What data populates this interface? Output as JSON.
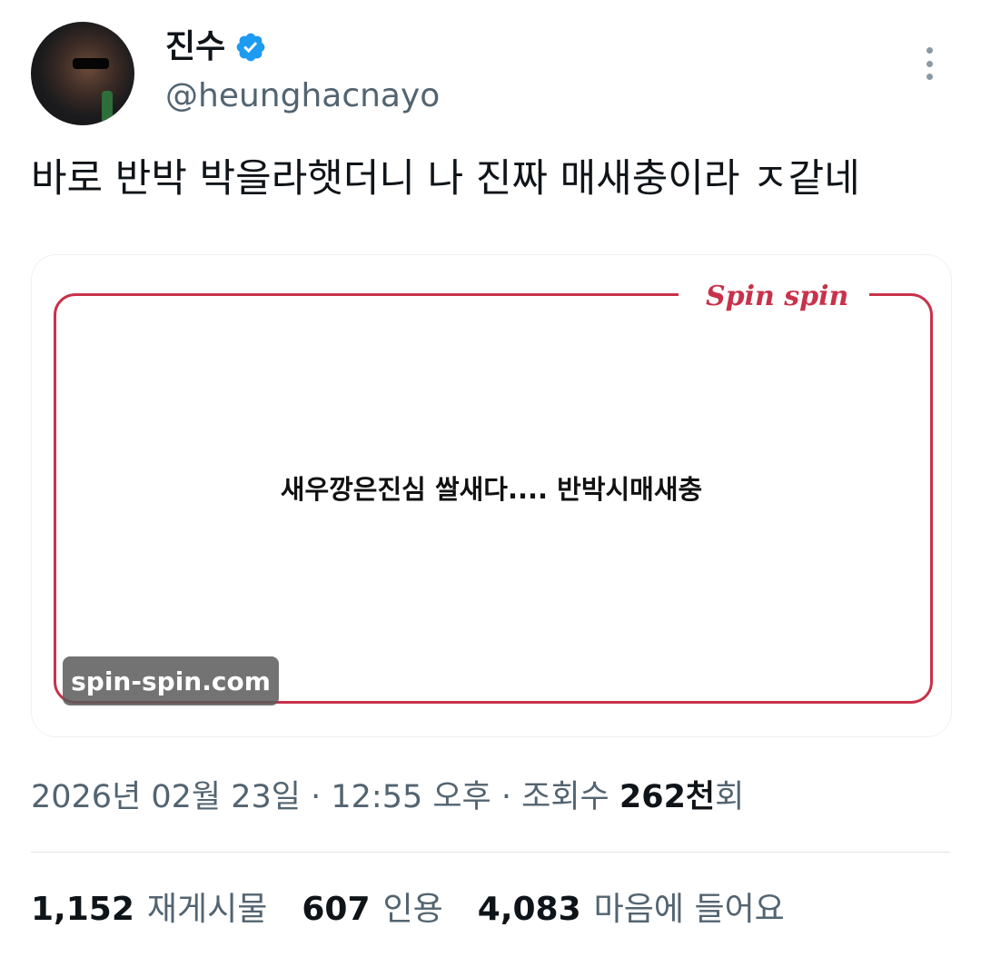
{
  "author": {
    "display_name": "진수",
    "handle": "@heunghacnayo",
    "verified_color": "#1d9bf0"
  },
  "tweet": {
    "text": "바로 반박 박을라햇더니 나 진짜 매새충이라 ㅈ같네"
  },
  "media": {
    "brand": "Spin spin",
    "caption": "새우깡은진심 쌀새다.... 반박시매새충",
    "watermark": "spin-spin.com",
    "frame_color": "#c8324a"
  },
  "meta": {
    "datetime": "2026년 02월 23일 · 12:55 오후 · 조회수 ",
    "views_value": "262천",
    "views_suffix": "회"
  },
  "stats": {
    "retweets_count": "1,152",
    "retweets_label": "재게시물",
    "quotes_count": "607",
    "quotes_label": "인용",
    "likes_count": "4,083",
    "likes_label": "마음에 들어요"
  }
}
